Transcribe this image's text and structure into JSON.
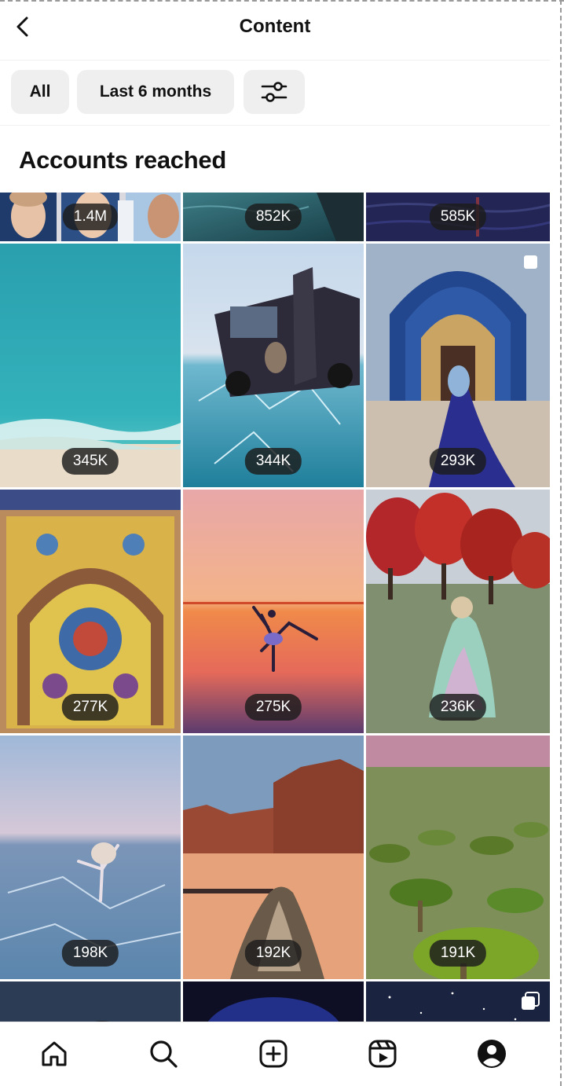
{
  "header": {
    "title": "Content"
  },
  "filters": {
    "all_label": "All",
    "range_label": "Last 6 months"
  },
  "section": {
    "title": "Accounts reached"
  },
  "posts": [
    {
      "reach": "1.4M",
      "scene": "faces"
    },
    {
      "reach": "852K",
      "scene": "dark-water"
    },
    {
      "reach": "585K",
      "scene": "night-water"
    },
    {
      "reach": "345K",
      "scene": "turquoise-sea"
    },
    {
      "reach": "344K",
      "scene": "van-on-ice"
    },
    {
      "reach": "293K",
      "scene": "mosque-portal",
      "multi": true
    },
    {
      "reach": "277K",
      "scene": "tile-mosaic"
    },
    {
      "reach": "275K",
      "scene": "sunset-dancer"
    },
    {
      "reach": "236K",
      "scene": "red-trees-lake"
    },
    {
      "reach": "198K",
      "scene": "ice-dancer"
    },
    {
      "reach": "192K",
      "scene": "desert-rocks"
    },
    {
      "reach": "191K",
      "scene": "dragon-trees"
    },
    {
      "reach": "",
      "scene": "dark-sky"
    },
    {
      "reach": "",
      "scene": "blue-night"
    },
    {
      "reach": "",
      "scene": "starry-sky",
      "multi": true
    }
  ],
  "tabbar": {
    "items": [
      "home-icon",
      "search-icon",
      "create-icon",
      "reels-icon",
      "profile-icon"
    ]
  },
  "colors": {
    "text": "#111111",
    "chip": "#efefef",
    "badge": "#1c1c1c"
  }
}
